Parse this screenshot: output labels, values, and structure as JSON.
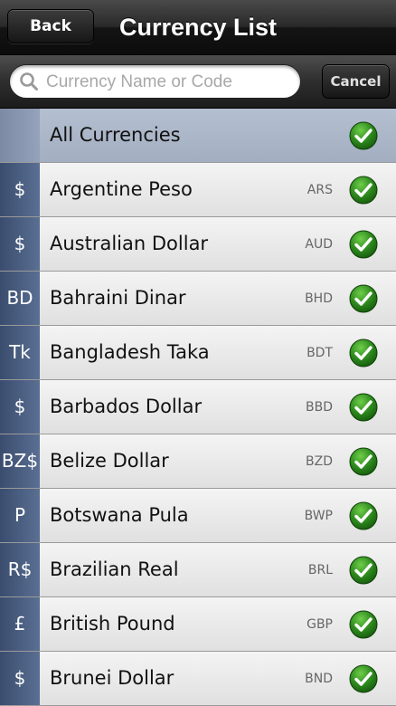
{
  "navbar": {
    "back_label": "Back",
    "title": "Currency List"
  },
  "search": {
    "placeholder": "Currency Name or Code",
    "value": "",
    "cancel_label": "Cancel"
  },
  "list": {
    "all": {
      "label": "All Currencies",
      "selected": true
    },
    "items": [
      {
        "symbol": "$",
        "name": "Argentine Peso",
        "code": "ARS",
        "checked": true
      },
      {
        "symbol": "$",
        "name": "Australian Dollar",
        "code": "AUD",
        "checked": true
      },
      {
        "symbol": "BD",
        "name": "Bahraini Dinar",
        "code": "BHD",
        "checked": true
      },
      {
        "symbol": "Tk",
        "name": "Bangladesh Taka",
        "code": "BDT",
        "checked": true
      },
      {
        "symbol": "$",
        "name": "Barbados Dollar",
        "code": "BBD",
        "checked": true
      },
      {
        "symbol": "BZ$",
        "name": "Belize Dollar",
        "code": "BZD",
        "checked": true
      },
      {
        "symbol": "P",
        "name": "Botswana Pula",
        "code": "BWP",
        "checked": true
      },
      {
        "symbol": "R$",
        "name": "Brazilian Real",
        "code": "BRL",
        "checked": true
      },
      {
        "symbol": "£",
        "name": "British Pound",
        "code": "GBP",
        "checked": true
      },
      {
        "symbol": "$",
        "name": "Brunei Dollar",
        "code": "BND",
        "checked": true
      }
    ]
  },
  "colors": {
    "check_green": "#2e8a1e",
    "accent_blue": "#4a5f84"
  },
  "icons": {
    "search": "magnifier-icon",
    "check": "checkmark-icon"
  }
}
